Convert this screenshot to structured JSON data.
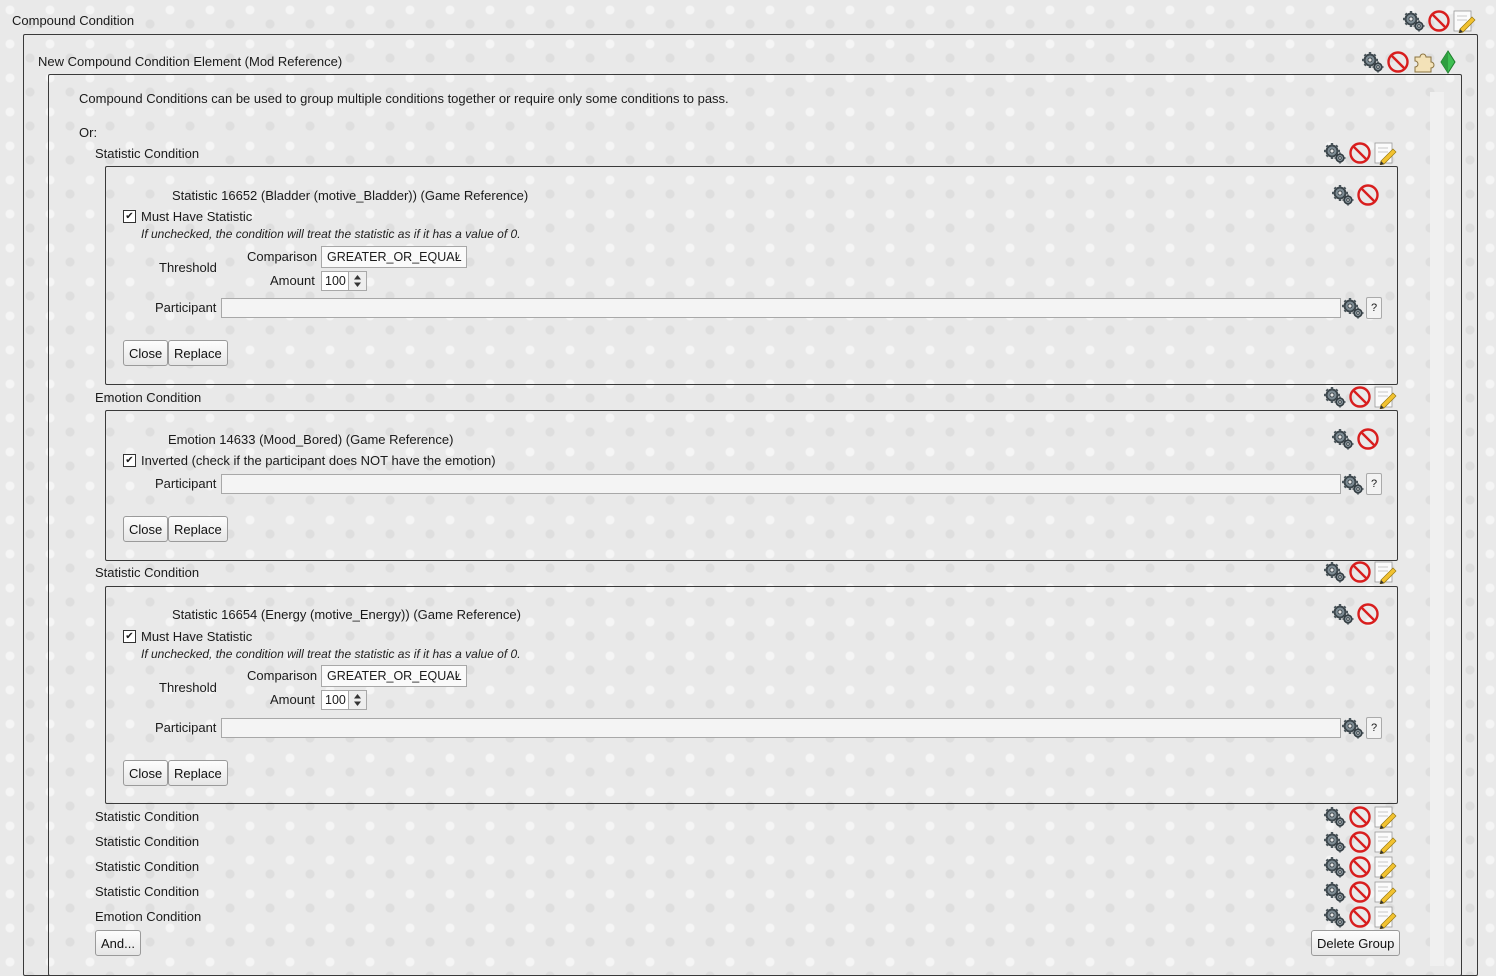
{
  "compound": {
    "title": "Compound Condition",
    "element_title": "New Compound Condition Element (Mod Reference)",
    "description": "Compound Conditions can be used to group multiple conditions together or require only some conditions to pass.",
    "or_label": "Or:"
  },
  "cond1": {
    "header": "Statistic Condition",
    "ref": "Statistic  16652 (Bladder (motive_Bladder)) (Game Reference)",
    "checkbox_label": "Must Have Statistic",
    "checkbox_checked": true,
    "hint": "If unchecked, the condition will treat the statistic as if it has a value of 0.",
    "threshold_label": "Threshold",
    "comparison_label": "Comparison",
    "comparison_value": "GREATER_OR_EQUAL",
    "amount_label": "Amount",
    "amount_value": "100",
    "participant_label": "Participant",
    "participant_value": "",
    "close_label": "Close",
    "replace_label": "Replace"
  },
  "cond2": {
    "header": "Emotion Condition",
    "ref": "Emotion  14633 (Mood_Bored) (Game Reference)",
    "checkbox_label": "Inverted (check if the participant does NOT have the emotion)",
    "checkbox_checked": true,
    "participant_label": "Participant",
    "participant_value": "",
    "close_label": "Close",
    "replace_label": "Replace"
  },
  "cond3": {
    "header": "Statistic Condition",
    "ref": "Statistic  16654 (Energy (motive_Energy)) (Game Reference)",
    "checkbox_label": "Must Have Statistic",
    "checkbox_checked": true,
    "hint": "If unchecked, the condition will treat the statistic as if it has a value of 0.",
    "threshold_label": "Threshold",
    "comparison_label": "Comparison",
    "comparison_value": "GREATER_OR_EQUAL",
    "amount_label": "Amount",
    "amount_value": "100",
    "participant_label": "Participant",
    "participant_value": "",
    "close_label": "Close",
    "replace_label": "Replace"
  },
  "collapsed": [
    "Statistic Condition",
    "Statistic Condition",
    "Statistic Condition",
    "Statistic Condition",
    "Emotion Condition"
  ],
  "buttons": {
    "and_label": "And...",
    "delete_group_label": "Delete Group",
    "help_label": "?"
  },
  "icons": [
    "gears-icon",
    "no-entry-icon",
    "pencil-icon",
    "puzzle-icon",
    "plumbob-icon"
  ],
  "colors": {
    "border": "#3a3a3a",
    "no_entry": "#d81e1e",
    "plumbob": "#36b24a"
  }
}
